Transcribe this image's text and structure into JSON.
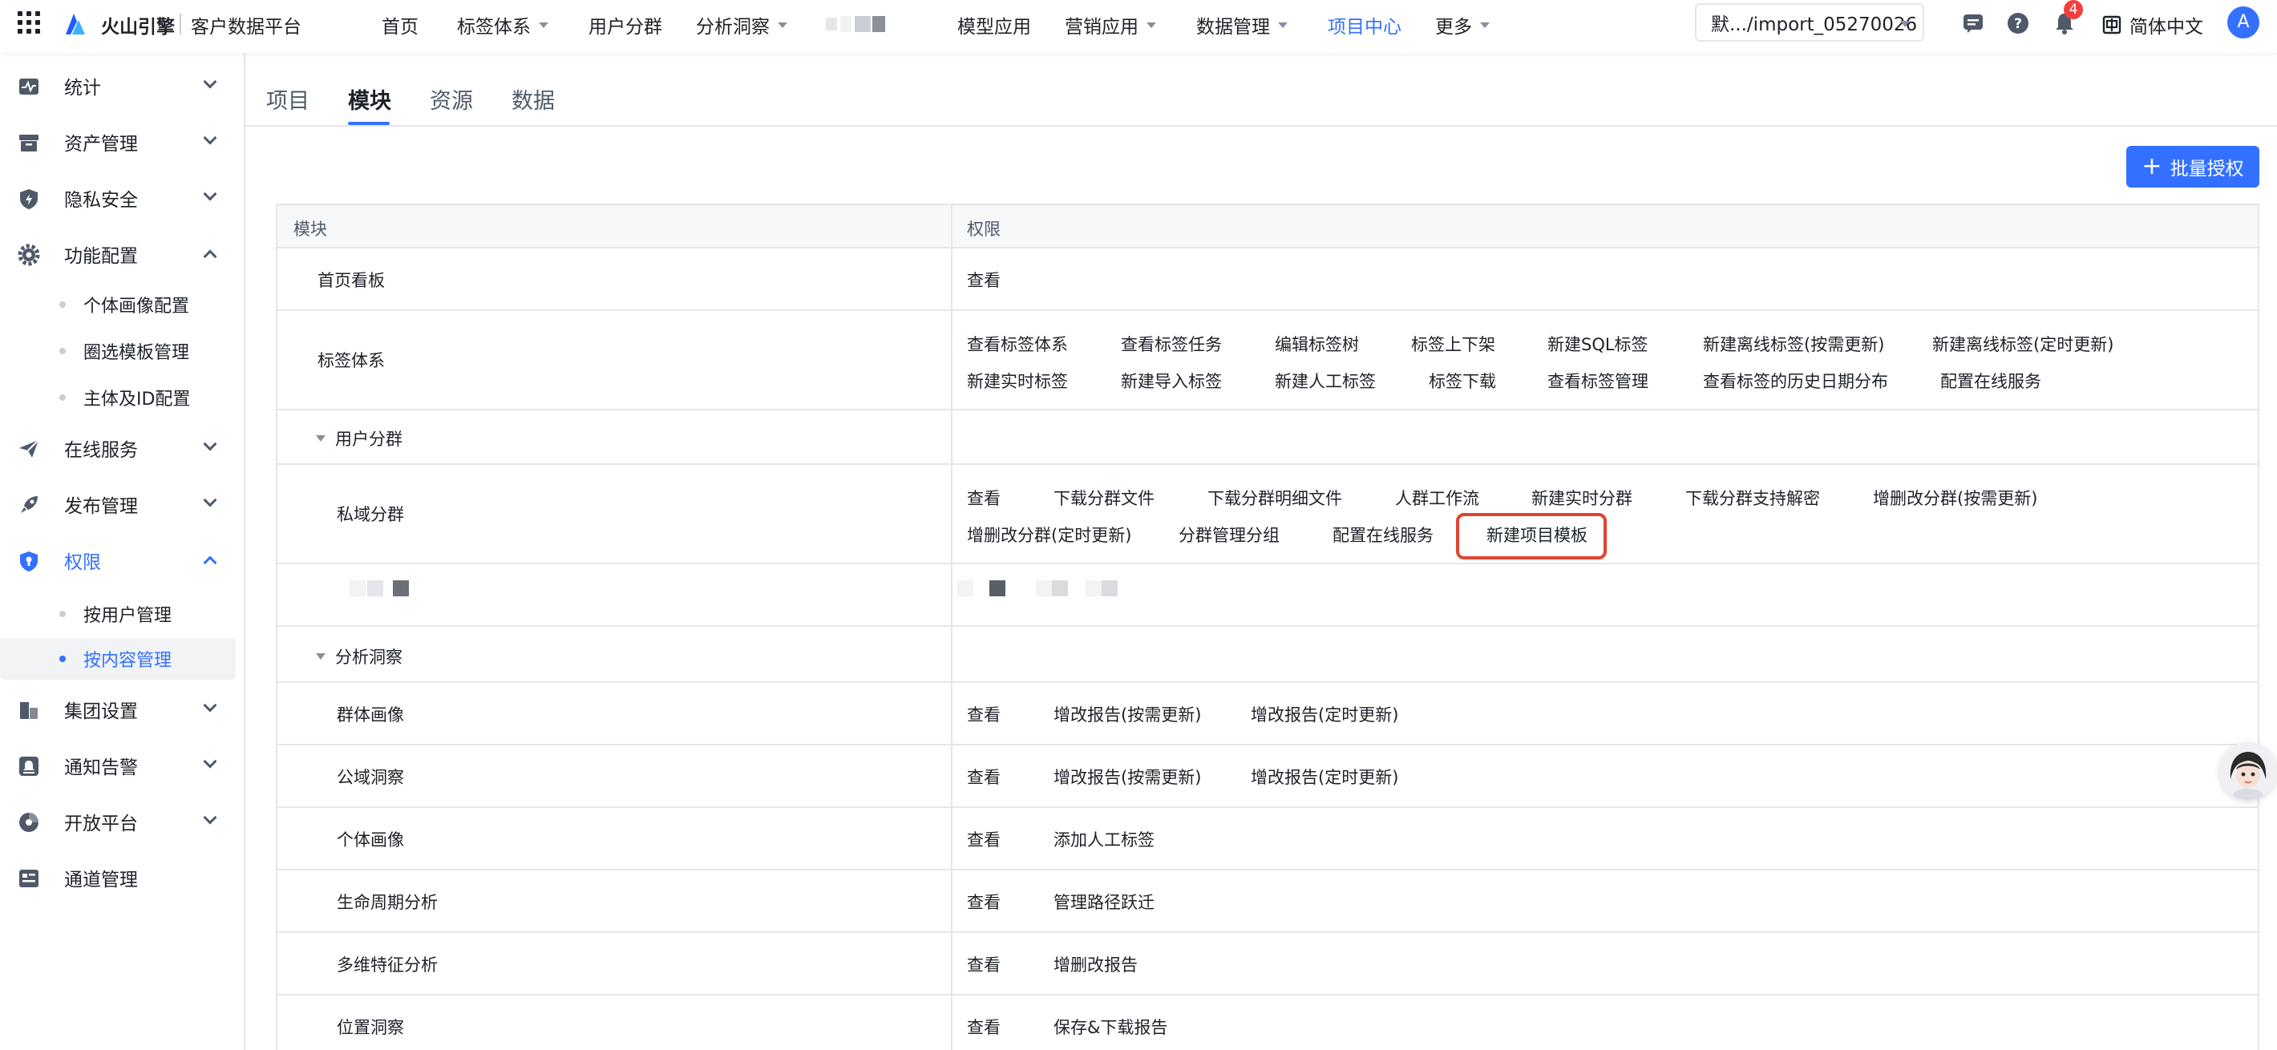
{
  "topbar": {
    "brand": "火山引擎",
    "product": "客户数据平台",
    "nav": [
      {
        "label": "首页"
      },
      {
        "label": "标签体系"
      },
      {
        "label": "用户分群"
      },
      {
        "label": "分析洞察"
      },
      {
        "label": "模型应用"
      },
      {
        "label": "营销应用"
      },
      {
        "label": "数据管理"
      },
      {
        "label": "项目中心"
      },
      {
        "label": "更多"
      }
    ],
    "project_select": "默.../import_05270026",
    "notification_count": "4",
    "language": "简体中文",
    "avatar_letter": "A"
  },
  "sidebar": {
    "items": [
      {
        "label": "统计",
        "icon": "stats-icon"
      },
      {
        "label": "资产管理",
        "icon": "archive-icon"
      },
      {
        "label": "隐私安全",
        "icon": "shield-icon"
      },
      {
        "label": "功能配置",
        "icon": "gear-icon"
      },
      {
        "label": "在线服务",
        "icon": "send-icon"
      },
      {
        "label": "发布管理",
        "icon": "rocket-icon"
      },
      {
        "label": "权限",
        "icon": "lock-shield-icon"
      },
      {
        "label": "集团设置",
        "icon": "building-icon"
      },
      {
        "label": "通知告警",
        "icon": "alarm-icon"
      },
      {
        "label": "开放平台",
        "icon": "platform-icon"
      },
      {
        "label": "通道管理",
        "icon": "channel-icon"
      }
    ],
    "func_sub": [
      "个体画像配置",
      "圈选模板管理",
      "主体及ID配置"
    ],
    "perm_sub": [
      "按用户管理",
      "按内容管理"
    ]
  },
  "tabs": [
    "项目",
    "模块",
    "资源",
    "数据"
  ],
  "batch_button": "批量授权",
  "table": {
    "headers": [
      "模块",
      "权限"
    ],
    "rows": {
      "home": {
        "module": "首页看板",
        "perms": [
          "查看"
        ]
      },
      "tags": {
        "module": "标签体系",
        "perms1": [
          "查看标签体系",
          "查看标签任务",
          "编辑标签树",
          "标签上下架",
          "新建SQL标签",
          "新建离线标签(按需更新)",
          "新建离线标签(定时更新)"
        ],
        "perms2": [
          "新建实时标签",
          "新建导入标签",
          "新建人工标签",
          "标签下载",
          "查看标签管理",
          "查看标签的历史日期分布",
          "配置在线服务"
        ]
      },
      "segment_group": {
        "module": "用户分群"
      },
      "private": {
        "module": "私域分群",
        "perms1": [
          "查看",
          "下载分群文件",
          "下载分群明细文件",
          "人群工作流",
          "新建实时分群",
          "下载分群支持解密",
          "增删改分群(按需更新)"
        ],
        "perms2": [
          "增删改分群(定时更新)",
          "分群管理分组",
          "配置在线服务",
          "新建项目模板"
        ]
      },
      "insight_group": {
        "module": "分析洞察"
      },
      "group_portrait": {
        "module": "群体画像",
        "perms": [
          "查看",
          "增改报告(按需更新)",
          "增改报告(定时更新)"
        ]
      },
      "public_insight": {
        "module": "公域洞察",
        "perms": [
          "查看",
          "增改报告(按需更新)",
          "增改报告(定时更新)"
        ]
      },
      "personal": {
        "module": "个体画像",
        "perms": [
          "查看",
          "添加人工标签"
        ]
      },
      "lifecycle": {
        "module": "生命周期分析",
        "perms": [
          "查看",
          "管理路径跃迁"
        ]
      },
      "multidim": {
        "module": "多维特征分析",
        "perms": [
          "查看",
          "增删改报告"
        ]
      },
      "location": {
        "module": "位置洞察",
        "perms": [
          "查看",
          "保存&下载报告"
        ]
      }
    }
  },
  "colors": {
    "accent": "#3370ff",
    "highlight": "#e0442f",
    "badge": "#f53f3f"
  }
}
